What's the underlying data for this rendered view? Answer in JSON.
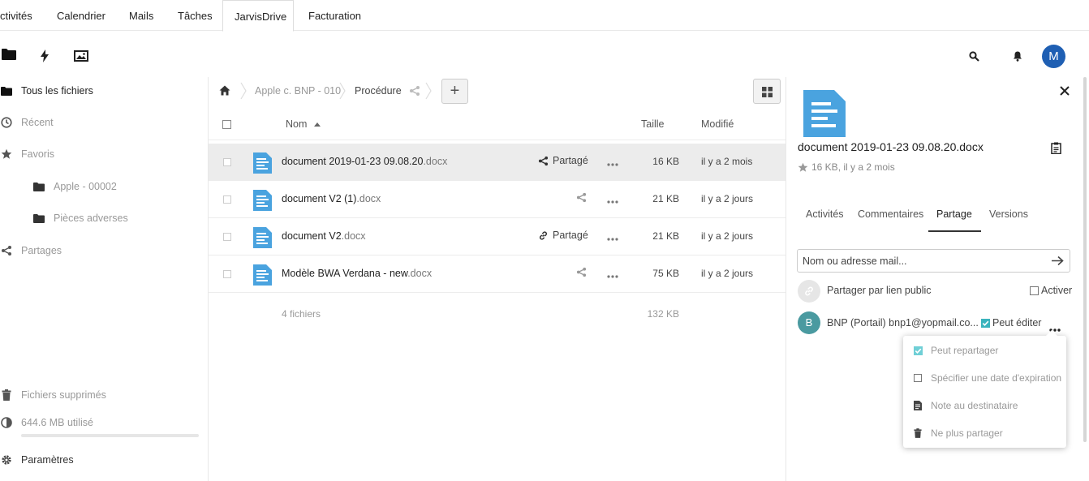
{
  "topnav": {
    "tabs": [
      {
        "label": "ctivités"
      },
      {
        "label": "Calendrier"
      },
      {
        "label": "Mails"
      },
      {
        "label": "Tâches"
      },
      {
        "label": "JarvisDrive"
      },
      {
        "label": "Facturation"
      }
    ],
    "active_tab": "JarvisDrive"
  },
  "user": {
    "avatar_initial": "M",
    "avatar_color": "#1f5fb3"
  },
  "leftnav": {
    "items": [
      {
        "label": "Tous les fichiers",
        "icon": "folder-icon"
      },
      {
        "label": "Récent",
        "icon": "clock-icon"
      },
      {
        "label": "Favoris",
        "icon": "star-icon"
      },
      {
        "label": "Apple - 00002",
        "icon": "folder-icon"
      },
      {
        "label": "Pièces adverses",
        "icon": "folder-icon"
      },
      {
        "label": "Partages",
        "icon": "share-icon"
      }
    ],
    "bottom": {
      "trash": "Fichiers supprimés",
      "quota": "644.6 MB utilisé",
      "settings": "Paramètres"
    }
  },
  "breadcrumb": {
    "items": [
      "Apple c. BNP - 010",
      "Procédure"
    ]
  },
  "filelist": {
    "columns": {
      "name": "Nom",
      "size": "Taille",
      "modified": "Modifié"
    },
    "rows": [
      {
        "base": "document 2019-01-23 09.08.20",
        "ext": ".docx",
        "share_label": "Partagé",
        "share_icon": "share-icon",
        "size": "16 KB",
        "modified": "il y a 2 mois"
      },
      {
        "base": "document V2 (1)",
        "ext": ".docx",
        "share_label": "",
        "share_icon": "share-icon",
        "size": "21 KB",
        "modified": "il y a 2 jours"
      },
      {
        "base": "document V2",
        "ext": ".docx",
        "share_label": "Partagé",
        "share_icon": "link-icon",
        "size": "21 KB",
        "modified": "il y a 2 jours"
      },
      {
        "base": "Modèle BWA Verdana - new",
        "ext": ".docx",
        "share_label": "",
        "share_icon": "share-icon",
        "size": "75 KB",
        "modified": "il y a 2 jours"
      }
    ],
    "summary": {
      "count": "4 fichiers",
      "total": "132 KB"
    }
  },
  "sidebar": {
    "filename": "document 2019-01-23 09.08.20.docx",
    "meta": "16 KB, il y a 2 mois",
    "tabs": [
      "Activités",
      "Commentaires",
      "Partage",
      "Versions"
    ],
    "active_tab": "Partage",
    "share_input_placeholder": "Nom ou adresse mail...",
    "public_link_label": "Partager par lien public",
    "public_link_toggle": "Activer",
    "sharee": {
      "initial": "B",
      "label": "BNP (Portail) bnp1@yopmail.co...",
      "can_edit": "Peut éditer",
      "avatar_color": "#4a9aa0"
    },
    "menu": [
      {
        "label": "Peut repartager",
        "icon": "checkbox-checked-icon"
      },
      {
        "label": "Spécifier une date d'expiration",
        "icon": "checkbox-icon"
      },
      {
        "label": "Note au destinataire",
        "icon": "note-icon"
      },
      {
        "label": "Ne plus partager",
        "icon": "trash-icon"
      }
    ]
  },
  "colors": {
    "accent": "#0082c9",
    "file_icon": "#4aa3df",
    "check": "#3ab3bd"
  }
}
